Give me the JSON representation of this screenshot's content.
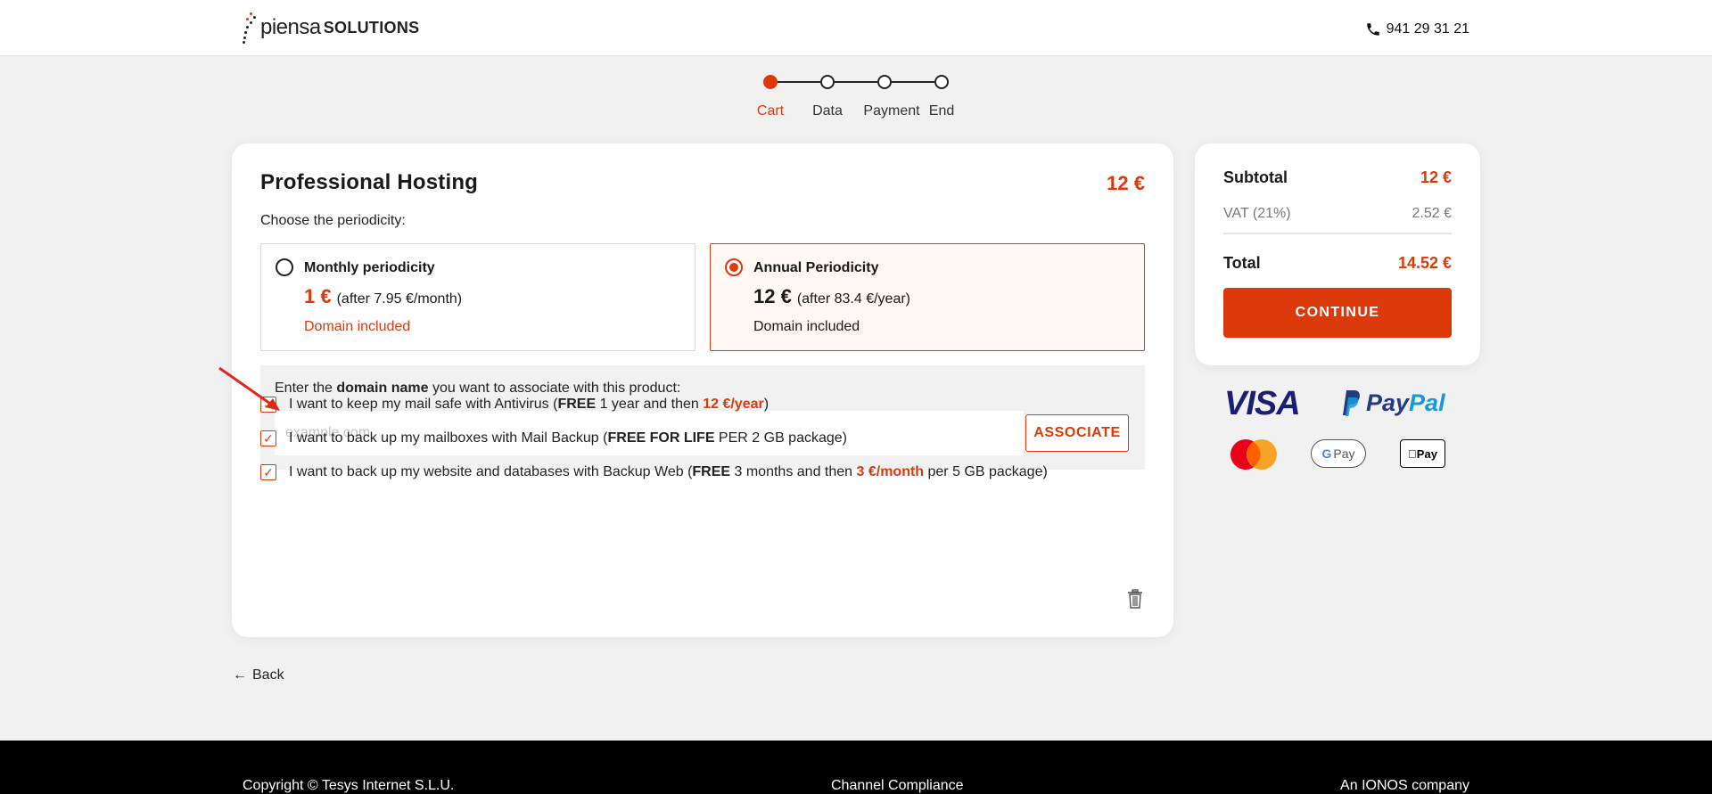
{
  "header": {
    "logo_light": "piensa",
    "logo_bold": "SOLUTIONS",
    "phone": "941 29 31 21"
  },
  "stepper": {
    "steps": [
      {
        "label": "Cart",
        "active": true
      },
      {
        "label": "Data",
        "active": false
      },
      {
        "label": "Payment",
        "active": false
      },
      {
        "label": "End",
        "active": false
      }
    ]
  },
  "product": {
    "title": "Professional Hosting",
    "price": "12 €",
    "periodicity_label": "Choose the periodicity:",
    "options": [
      {
        "name": "Monthly periodicity",
        "price": "1 €",
        "after": "(after 7.95 €/month)",
        "domain": "Domain included",
        "selected": false
      },
      {
        "name": "Annual Periodicity",
        "price": "12 €",
        "after": "(after 83.4 €/year)",
        "domain": "Domain included",
        "selected": true
      }
    ]
  },
  "domain": {
    "label_pre": "Enter the ",
    "label_bold": "domain name",
    "label_post": " you want to associate with this product:",
    "placeholder": "example.com",
    "value": "",
    "button": "ASSOCIATE"
  },
  "addons": [
    {
      "pre": "I want to keep my mail safe with Antivirus (",
      "bold": "FREE",
      "mid": " 1 year and then ",
      "accent": "12 €/year",
      "post": ")",
      "checked": true
    },
    {
      "pre": "I want to back up my mailboxes with Mail Backup (",
      "bold": "FREE FOR LIFE",
      "mid": " PER 2 GB package)",
      "accent": "",
      "post": "",
      "checked": true
    },
    {
      "pre": "I want to back up my website and databases with Backup Web (",
      "bold": "FREE",
      "mid": " 3 months and then ",
      "accent": "3 €/month",
      "post": " per 5 GB package)",
      "checked": true
    }
  ],
  "back_label": "Back",
  "summary": {
    "subtotal_label": "Subtotal",
    "subtotal_value": "12 €",
    "vat_label": "VAT (21%)",
    "vat_value": "2.52 €",
    "total_label": "Total",
    "total_value": "14.52 €",
    "continue": "CONTINUE"
  },
  "payments": {
    "visa": "VISA",
    "paypal_a": "Pay",
    "paypal_b": "Pal",
    "gpay": "Pay",
    "applepay": "Pay"
  },
  "footer": {
    "copyright": "Copyright © Tesys Internet S.L.U.",
    "compliance": "Channel Compliance",
    "company": "An IONOS company"
  },
  "colors": {
    "accent": "#dc3a0b",
    "background": "#f1f1f1"
  }
}
